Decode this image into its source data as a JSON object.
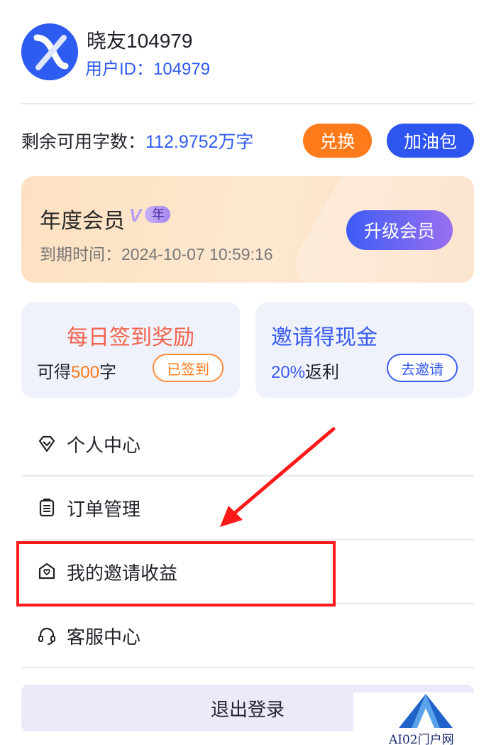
{
  "user": {
    "name": "晓友104979",
    "id_label": "用户ID：104979"
  },
  "quota": {
    "label": "剩余可用字数：",
    "value": "112.9752万字",
    "exchange_button": "兑换",
    "boost_button": "加油包"
  },
  "membership": {
    "title": "年度会员",
    "badge_v": "V",
    "badge_text": "年",
    "expire_text": "到期时间：2024-10-07 10:59:16",
    "upgrade_button": "升级会员"
  },
  "daily_sign": {
    "title": "每日签到奖励",
    "sub_prefix": "可得",
    "sub_value": "500",
    "sub_suffix": "字",
    "button": "已签到"
  },
  "invite_cash": {
    "title": "邀请得现金",
    "sub_value": "20%",
    "sub_suffix": "返利",
    "button": "去邀请"
  },
  "menu": {
    "items": [
      {
        "label": "个人中心",
        "icon": "diamond-icon"
      },
      {
        "label": "订单管理",
        "icon": "clipboard-icon"
      },
      {
        "label": "我的邀请收益",
        "icon": "invite-mail-icon"
      },
      {
        "label": "客服中心",
        "icon": "headset-icon"
      }
    ]
  },
  "logout_button": "退出登录",
  "watermark": {
    "text": "AI02门户网"
  },
  "colors": {
    "brand_blue": "#2f5cf0",
    "orange": "#ff7a1a",
    "annotation_red": "#ff1a1a"
  }
}
